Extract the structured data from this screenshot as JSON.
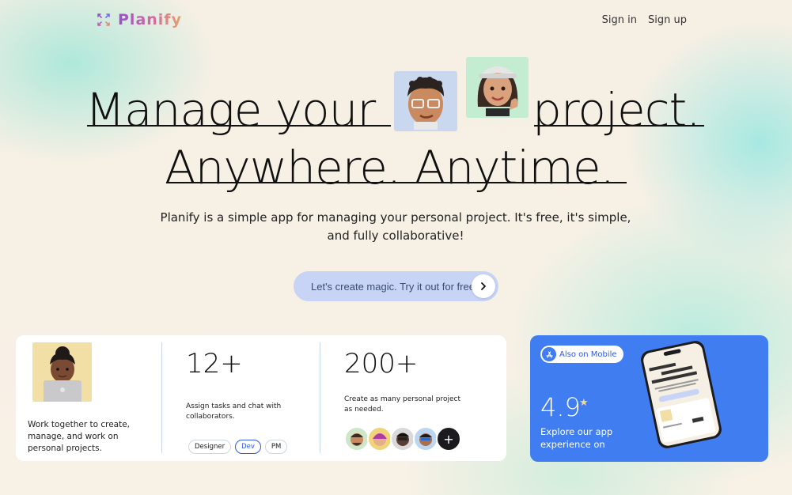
{
  "header": {
    "brand": "Planify",
    "nav": {
      "signin": "Sign in",
      "signup": "Sign up"
    }
  },
  "hero": {
    "line1_left": "Manage your",
    "line1_right": "project.",
    "line2": "Anywhere. Anytime.",
    "subtitle": "Planify is a simple app for managing your personal project. It's free, it's simple, and fully collaborative!",
    "cta_label": "Let's create magic. Try it out for free"
  },
  "stats": {
    "work_text": "Work together to create, manage, and work on personal projects.",
    "tasks": {
      "number": "12+",
      "desc": "Assign tasks and chat with collaborators."
    },
    "chips": [
      "Designer",
      "Dev",
      "PM"
    ],
    "projects": {
      "number": "200+",
      "desc": "Create as many personal project as needed."
    },
    "more_symbol": "+"
  },
  "mobile": {
    "badge": "Also on Mobile",
    "rating": "4.9",
    "star": "★",
    "explore": "Explore our app experience on"
  },
  "colors": {
    "cta_bg": "#c7d4f6",
    "mobile_bg": "#3f7df0",
    "chip_active": "#2f57e4",
    "brand_gradient_start": "#9a4fd1",
    "brand_gradient_end": "#e8a36a"
  }
}
